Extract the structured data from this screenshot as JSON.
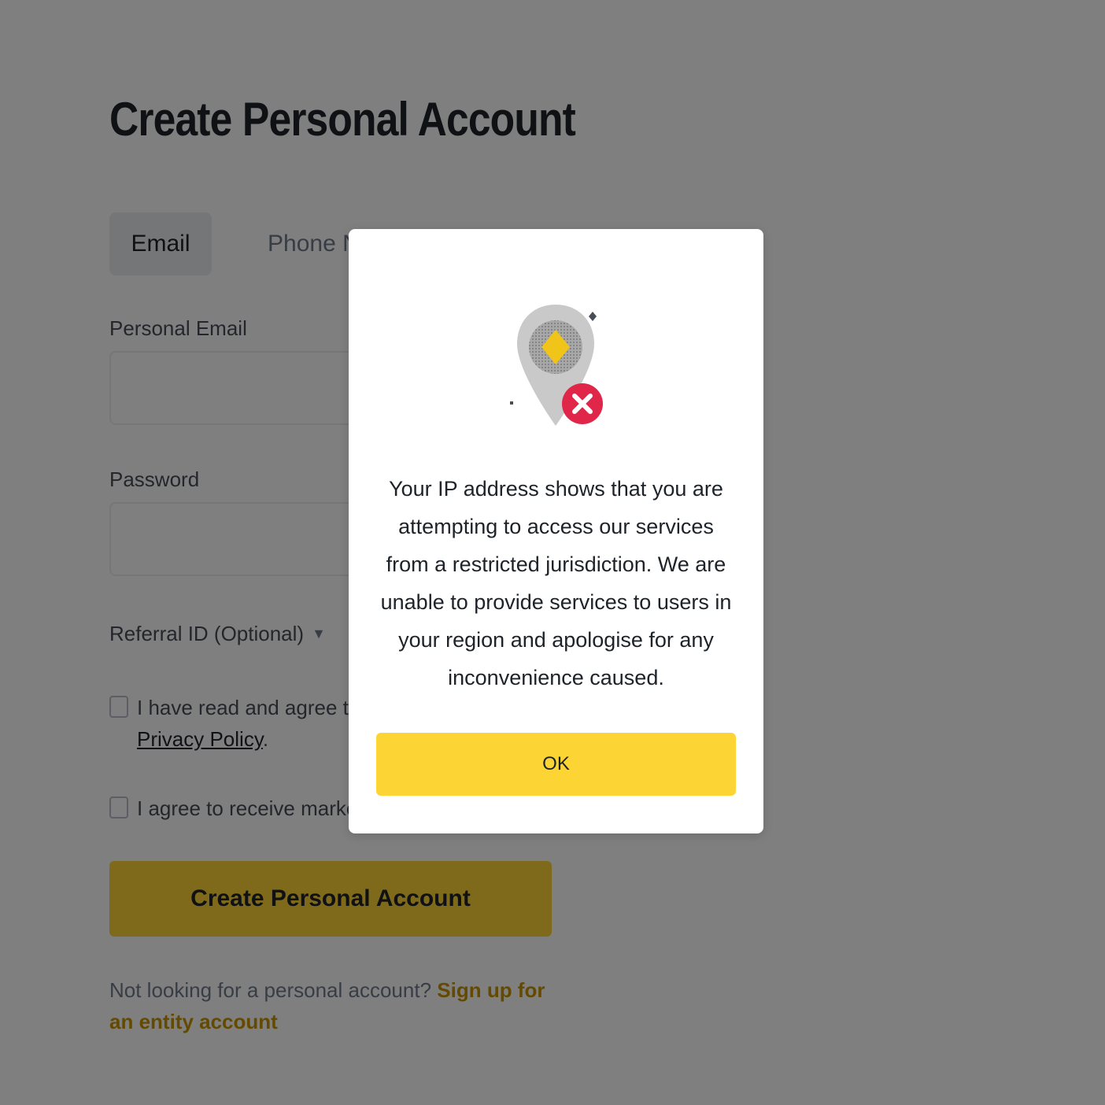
{
  "page": {
    "title": "Create Personal Account",
    "tabs": [
      {
        "label": "Email",
        "active": true
      },
      {
        "label": "Phone Nu",
        "active": false
      }
    ],
    "fields": {
      "email_label": "Personal Email",
      "email_value": "",
      "password_label": "Password",
      "password_value": ""
    },
    "referral_label": "Referral ID (Optional)",
    "terms_checkbox": {
      "line1": "I have read and agree to Bina",
      "link": "Privacy Policy",
      "suffix": "."
    },
    "marketing_checkbox": {
      "text": "I agree to receive marketing u"
    },
    "submit_label": "Create Personal Account",
    "footer": {
      "prompt": "Not looking for a personal account?",
      "link": "Sign up for an entity account"
    }
  },
  "modal": {
    "icon": "location-pin-restricted-icon",
    "message": "Your IP address shows that you are attempting to access our services from a restricted jurisdiction. We are unable to provide services to users in your region and apologise for any inconvenience caused.",
    "ok_label": "OK"
  },
  "colors": {
    "accent": "#fcd535",
    "link": "#c99400",
    "error": "#e0274a",
    "overlay": "rgba(0,0,0,0.5)"
  }
}
